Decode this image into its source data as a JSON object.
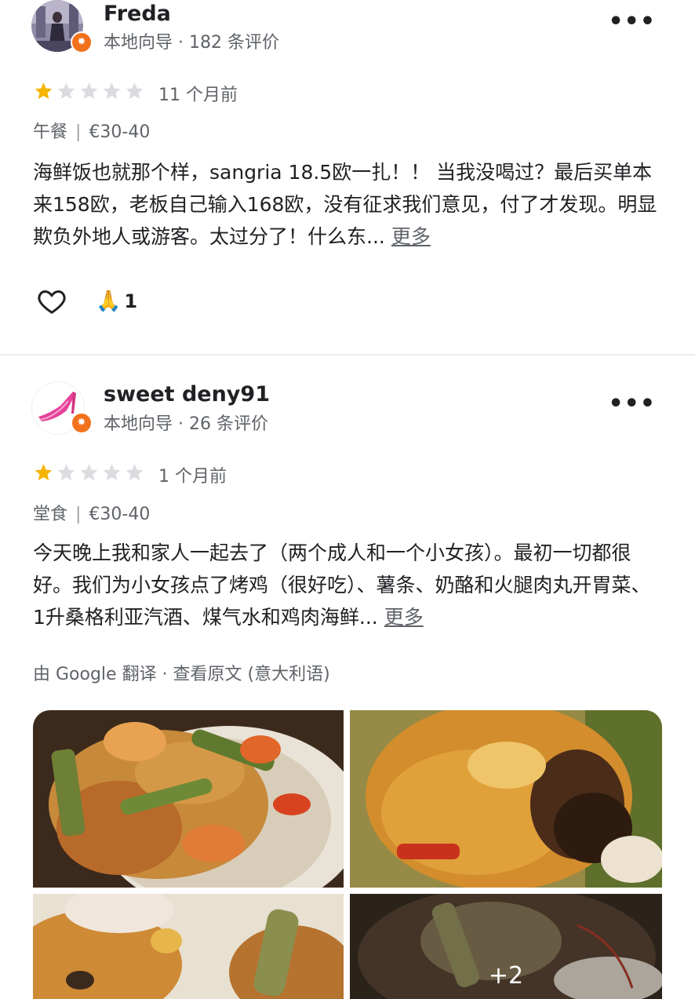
{
  "reviews": [
    {
      "author": "Freda",
      "meta": "本地向导 · 182 条评价",
      "rating": 1,
      "time": "11 个月前",
      "meal": "午餐",
      "price": "€30-40",
      "text": "海鲜饭也就那个样，sangria 18.5欧一扎！！ 当我没喝过？最后买单本来158欧，老板自己输入168欧，没有征求我们意见，付了才发现。明显欺负外地人或游客。太过分了！什么东...",
      "more_label": "更多",
      "reaction_icon": "🙏",
      "reaction_count": "1"
    },
    {
      "author": "sweet deny91",
      "meta": "本地向导 · 26 条评价",
      "rating": 1,
      "time": "1 个月前",
      "meal": "堂食",
      "price": "€30-40",
      "text": "今天晚上我和家人一起去了（两个成人和一个小女孩）。最初一切都很好。我们为小女孩点了烤鸡（很好吃）、薯条、奶酪和火腿肉丸开胃菜、1升桑格利亚汽酒、煤气水和鸡肉海鲜...",
      "more_label": "更多",
      "translation_note": "由 Google 翻译 · 查看原文 (意大利语)",
      "extra_photos_label": "+2"
    }
  ],
  "icons": {
    "menu": "more-vert-icon",
    "like": "heart-outline-icon",
    "guide_badge": "local-guide-badge-icon"
  },
  "colors": {
    "star_filled": "#f5b400",
    "star_empty": "#dadce0",
    "badge": "#f2711c"
  }
}
